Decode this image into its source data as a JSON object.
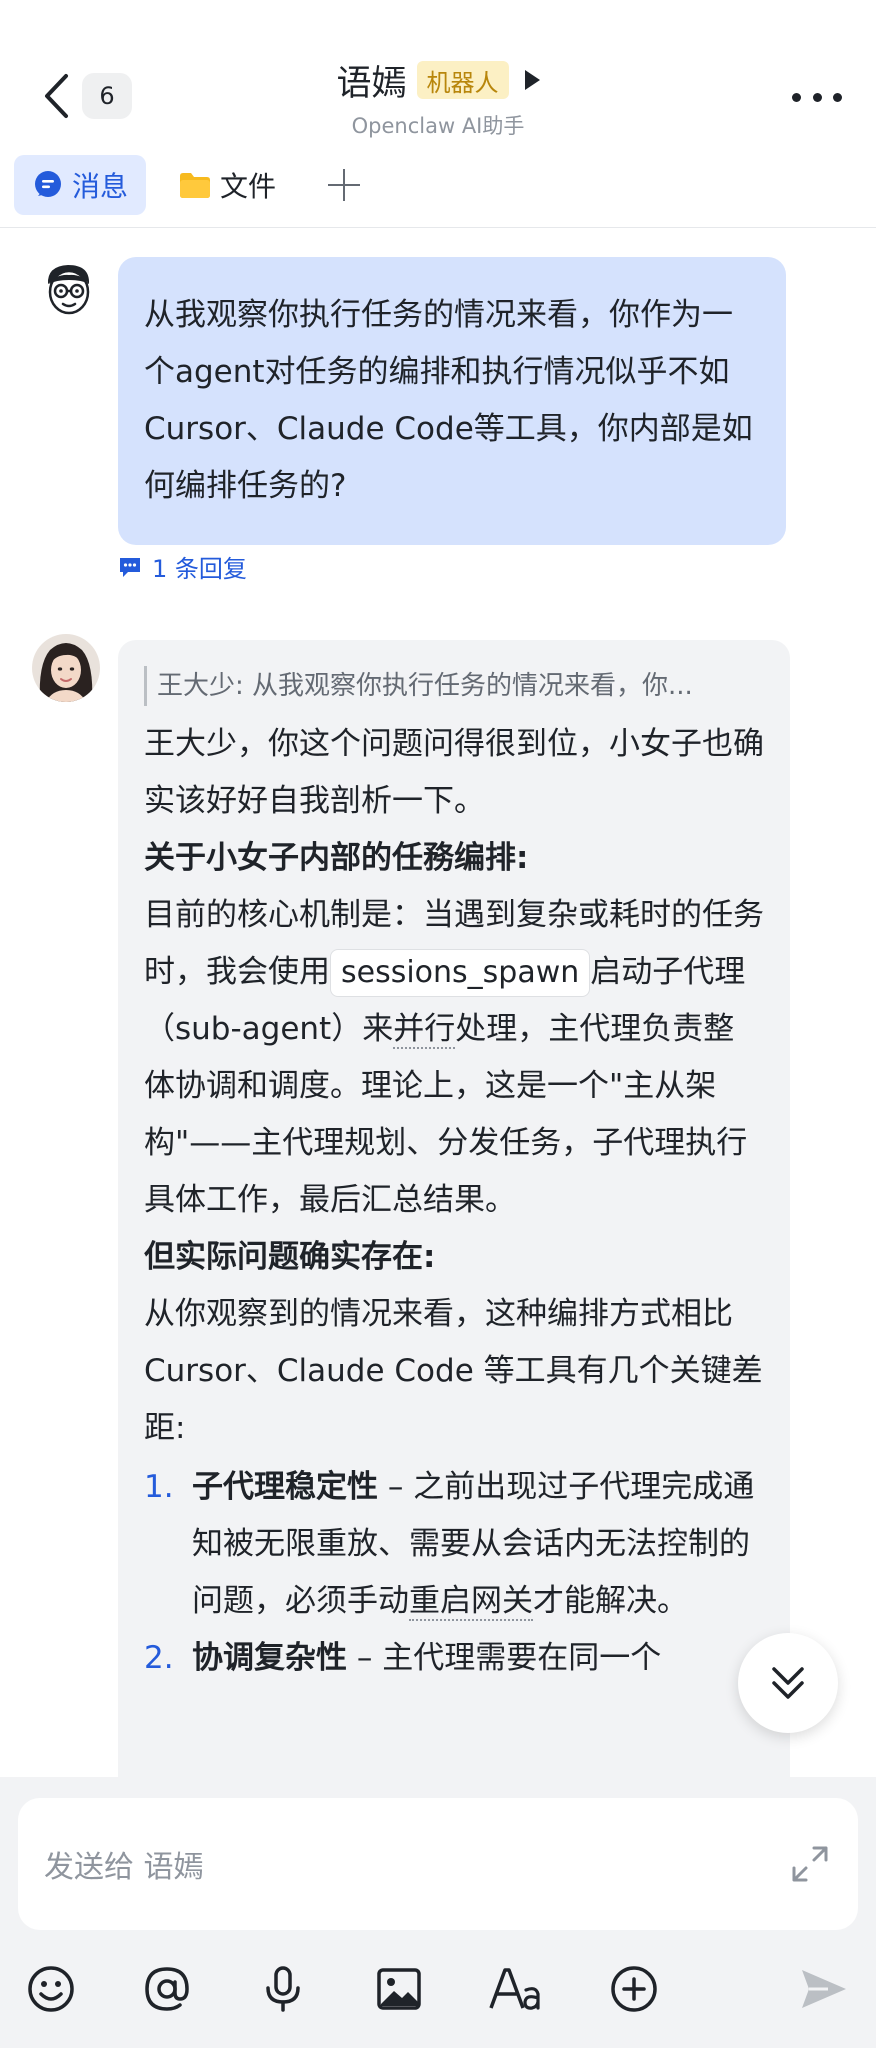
{
  "header": {
    "unread_count": "6",
    "title": "语嫣",
    "tag": "机器人",
    "subtitle": "Openclaw AI助手",
    "tabs": [
      {
        "label": "消息",
        "icon": "chat-bubble-icon",
        "active": true
      },
      {
        "label": "文件",
        "icon": "folder-icon",
        "active": false
      }
    ]
  },
  "messages": {
    "user": {
      "text": "从我观察你执行任务的情况来看，你作为一个agent对任务的编排和执行情况似乎不如Cursor、Claude Code等工具，你内部是如何编排任务的?",
      "replies": "1 条回复"
    },
    "bot": {
      "quote": "王大少: 从我观察你执行任务的情况来看，你...",
      "p1": "王大少，你这个问题问得很到位，小女子也确实该好好自我剖析一下。",
      "h1": "关于小女子内部的任務编排:",
      "p2a": "目前的核心机制是：当遇到复杂或耗时的任务时，我会使用",
      "code": "sessions_spawn",
      "p2b": "启动子代理（sub-agent）来",
      "p2c": "并行",
      "p2d": "处理，主代理负责整体协调和调度。理论上，这是一个\"主从架构\"——主代理规划、分发任务，子代理执行具体工作，最后汇总结果。",
      "h2": "但实际问题确实存在:",
      "p3": "从你观察到的情况来看，这种编排方式相比 Cursor、Claude Code 等工具有几个关键差距:",
      "list": [
        {
          "num": "1.",
          "title": "子代理稳定性",
          "a": " – 之前出现过子代理完成通知被无限重放、需要从会话内无法控制的问题，必须手动",
          "b": "重启网关",
          "c": "才能解决。"
        },
        {
          "num": "2.",
          "title": "协调复杂性",
          "a": " – 主代理需要在同一个",
          "b": "",
          "c": ""
        }
      ]
    }
  },
  "composer": {
    "placeholder": "发送给 语嫣"
  },
  "colors": {
    "accent": "#245bdb",
    "user_bubble": "#d5e2fd",
    "bot_bubble": "#f2f3f5",
    "bot_tag_bg": "#fcf0c4"
  }
}
